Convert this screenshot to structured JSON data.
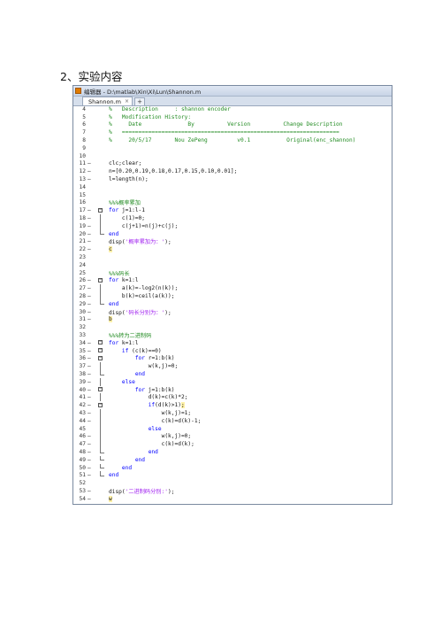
{
  "document": {
    "heading": "2、实验内容"
  },
  "window": {
    "title": "编辑器 - D:\\matlab\\Xin\\Xi\\Lun\\Shannon.m",
    "tab_label": "Shannon.m",
    "tab_close": "×",
    "tab_add": "+"
  },
  "code_lines": [
    {
      "n": "4",
      "mk": "",
      "f": "",
      "segs": [
        {
          "t": "%   Description     : shannon encoder",
          "c": "cm"
        }
      ]
    },
    {
      "n": "5",
      "mk": "",
      "f": "",
      "segs": [
        {
          "t": "%   Modification History:",
          "c": "cm"
        }
      ]
    },
    {
      "n": "6",
      "mk": "",
      "f": "",
      "segs": [
        {
          "t": "%     Date              By          Version          Change Description",
          "c": "cm"
        }
      ]
    },
    {
      "n": "7",
      "mk": "",
      "f": "",
      "segs": [
        {
          "t": "%   ==================================================================",
          "c": "cm"
        }
      ]
    },
    {
      "n": "8",
      "mk": "",
      "f": "",
      "segs": [
        {
          "t": "%     20/5/17       Nou ZePeng         v0.1           Original(enc_shannon)",
          "c": "cm"
        }
      ]
    },
    {
      "n": "9",
      "mk": "",
      "f": "",
      "segs": []
    },
    {
      "n": "10",
      "mk": "",
      "f": "",
      "segs": []
    },
    {
      "n": "11",
      "mk": "—",
      "f": "",
      "segs": [
        {
          "t": "clc;clear;",
          "c": ""
        }
      ]
    },
    {
      "n": "12",
      "mk": "—",
      "f": "",
      "segs": [
        {
          "t": "n=[0.20,0.19,0.18,0.17,0.15,0.10,0.01];",
          "c": ""
        }
      ]
    },
    {
      "n": "13",
      "mk": "—",
      "f": "",
      "segs": [
        {
          "t": "l=length(n);",
          "c": ""
        }
      ]
    },
    {
      "n": "14",
      "mk": "",
      "f": "",
      "segs": []
    },
    {
      "n": "15",
      "mk": "",
      "f": "",
      "segs": []
    },
    {
      "n": "16",
      "mk": "",
      "f": "",
      "segs": [
        {
          "t": "%%%概率累加",
          "c": "cm"
        }
      ]
    },
    {
      "n": "17",
      "mk": "—",
      "f": "box",
      "segs": [
        {
          "t": "for ",
          "c": "kw"
        },
        {
          "t": "j=1:l-1",
          "c": ""
        }
      ]
    },
    {
      "n": "18",
      "mk": "—",
      "f": "line",
      "segs": [
        {
          "t": "    c(1)=0;",
          "c": ""
        }
      ]
    },
    {
      "n": "19",
      "mk": "—",
      "f": "line",
      "segs": [
        {
          "t": "    c(j+1)=n(j)+c(j);",
          "c": ""
        }
      ]
    },
    {
      "n": "20",
      "mk": "—",
      "f": "end",
      "segs": [
        {
          "t": "end",
          "c": "kw"
        }
      ]
    },
    {
      "n": "21",
      "mk": "—",
      "f": "",
      "segs": [
        {
          "t": "disp(",
          "c": ""
        },
        {
          "t": "'概率累加为：'",
          "c": "str"
        },
        {
          "t": ");",
          "c": ""
        }
      ]
    },
    {
      "n": "22",
      "mk": "—",
      "f": "",
      "segs": [
        {
          "t": "c",
          "c": "cur"
        }
      ]
    },
    {
      "n": "23",
      "mk": "",
      "f": "",
      "segs": []
    },
    {
      "n": "24",
      "mk": "",
      "f": "",
      "segs": []
    },
    {
      "n": "25",
      "mk": "",
      "f": "",
      "segs": [
        {
          "t": "%%%码长",
          "c": "cm"
        }
      ]
    },
    {
      "n": "26",
      "mk": "—",
      "f": "box",
      "segs": [
        {
          "t": "for ",
          "c": "kw"
        },
        {
          "t": "k=1:l",
          "c": ""
        }
      ]
    },
    {
      "n": "27",
      "mk": "—",
      "f": "line",
      "segs": [
        {
          "t": "    a(k)=-log2(n(k));",
          "c": ""
        }
      ]
    },
    {
      "n": "28",
      "mk": "—",
      "f": "line",
      "segs": [
        {
          "t": "    b(k)=ceil(a(k));",
          "c": ""
        }
      ]
    },
    {
      "n": "29",
      "mk": "—",
      "f": "end",
      "segs": [
        {
          "t": "end",
          "c": "kw"
        }
      ]
    },
    {
      "n": "30",
      "mk": "—",
      "f": "",
      "segs": [
        {
          "t": "disp(",
          "c": ""
        },
        {
          "t": "'码长分别为：'",
          "c": "str"
        },
        {
          "t": ");",
          "c": ""
        }
      ]
    },
    {
      "n": "31",
      "mk": "—",
      "f": "",
      "segs": [
        {
          "t": "b",
          "c": "cur"
        }
      ]
    },
    {
      "n": "32",
      "mk": "",
      "f": "",
      "segs": []
    },
    {
      "n": "33",
      "mk": "",
      "f": "",
      "segs": [
        {
          "t": "%%%转为二进制码",
          "c": "cm"
        }
      ]
    },
    {
      "n": "34",
      "mk": "—",
      "f": "box",
      "segs": [
        {
          "t": "for ",
          "c": "kw"
        },
        {
          "t": "k=1:l",
          "c": ""
        }
      ]
    },
    {
      "n": "35",
      "mk": "—",
      "f": "box",
      "segs": [
        {
          "t": "    ",
          "c": ""
        },
        {
          "t": "if ",
          "c": "kw"
        },
        {
          "t": "(c(k)==0)",
          "c": ""
        }
      ]
    },
    {
      "n": "36",
      "mk": "—",
      "f": "box",
      "segs": [
        {
          "t": "        ",
          "c": ""
        },
        {
          "t": "for ",
          "c": "kw"
        },
        {
          "t": "r=1:b(k)",
          "c": ""
        }
      ]
    },
    {
      "n": "37",
      "mk": "—",
      "f": "line",
      "segs": [
        {
          "t": "            w(k,j)=0;",
          "c": ""
        }
      ]
    },
    {
      "n": "38",
      "mk": "—",
      "f": "end",
      "segs": [
        {
          "t": "        ",
          "c": ""
        },
        {
          "t": "end",
          "c": "kw"
        }
      ]
    },
    {
      "n": "39",
      "mk": "—",
      "f": "line",
      "segs": [
        {
          "t": "    ",
          "c": ""
        },
        {
          "t": "else",
          "c": "kw"
        }
      ]
    },
    {
      "n": "40",
      "mk": "—",
      "f": "box",
      "segs": [
        {
          "t": "        ",
          "c": ""
        },
        {
          "t": "for ",
          "c": "kw"
        },
        {
          "t": "j=1:b(k)",
          "c": ""
        }
      ]
    },
    {
      "n": "41",
      "mk": "—",
      "f": "line",
      "segs": [
        {
          "t": "            d(k)=c(k)*2;",
          "c": ""
        }
      ]
    },
    {
      "n": "42",
      "mk": "—",
      "f": "box",
      "segs": [
        {
          "t": "            ",
          "c": ""
        },
        {
          "t": "if",
          "c": "kw"
        },
        {
          "t": "(d(k)>1)",
          "c": ""
        },
        {
          "t": ";",
          "c": "cur"
        }
      ]
    },
    {
      "n": "43",
      "mk": "—",
      "f": "line",
      "segs": [
        {
          "t": "                w(k,j)=1;",
          "c": ""
        }
      ]
    },
    {
      "n": "44",
      "mk": "—",
      "f": "line",
      "segs": [
        {
          "t": "                c(k)=d(k)-1;",
          "c": ""
        }
      ]
    },
    {
      "n": "45",
      "mk": "",
      "f": "line",
      "segs": [
        {
          "t": "            ",
          "c": ""
        },
        {
          "t": "else",
          "c": "kw"
        }
      ]
    },
    {
      "n": "46",
      "mk": "—",
      "f": "line",
      "segs": [
        {
          "t": "                w(k,j)=0;",
          "c": ""
        }
      ]
    },
    {
      "n": "47",
      "mk": "—",
      "f": "line",
      "segs": [
        {
          "t": "                c(k)=d(k);",
          "c": ""
        }
      ]
    },
    {
      "n": "48",
      "mk": "—",
      "f": "end",
      "segs": [
        {
          "t": "            ",
          "c": ""
        },
        {
          "t": "end",
          "c": "kw"
        }
      ]
    },
    {
      "n": "49",
      "mk": "—",
      "f": "end",
      "segs": [
        {
          "t": "        ",
          "c": ""
        },
        {
          "t": "end",
          "c": "kw"
        }
      ]
    },
    {
      "n": "50",
      "mk": "—",
      "f": "end",
      "segs": [
        {
          "t": "    ",
          "c": ""
        },
        {
          "t": "end",
          "c": "kw"
        }
      ]
    },
    {
      "n": "51",
      "mk": "—",
      "f": "end",
      "segs": [
        {
          "t": "end",
          "c": "kw"
        }
      ]
    },
    {
      "n": "52",
      "mk": "",
      "f": "",
      "segs": []
    },
    {
      "n": "53",
      "mk": "—",
      "f": "",
      "segs": [
        {
          "t": "disp(",
          "c": ""
        },
        {
          "t": "'二进制码分别:'",
          "c": "str"
        },
        {
          "t": ");",
          "c": ""
        }
      ]
    },
    {
      "n": "54",
      "mk": "—",
      "f": "",
      "segs": [
        {
          "t": "w",
          "c": "cur"
        }
      ]
    }
  ]
}
